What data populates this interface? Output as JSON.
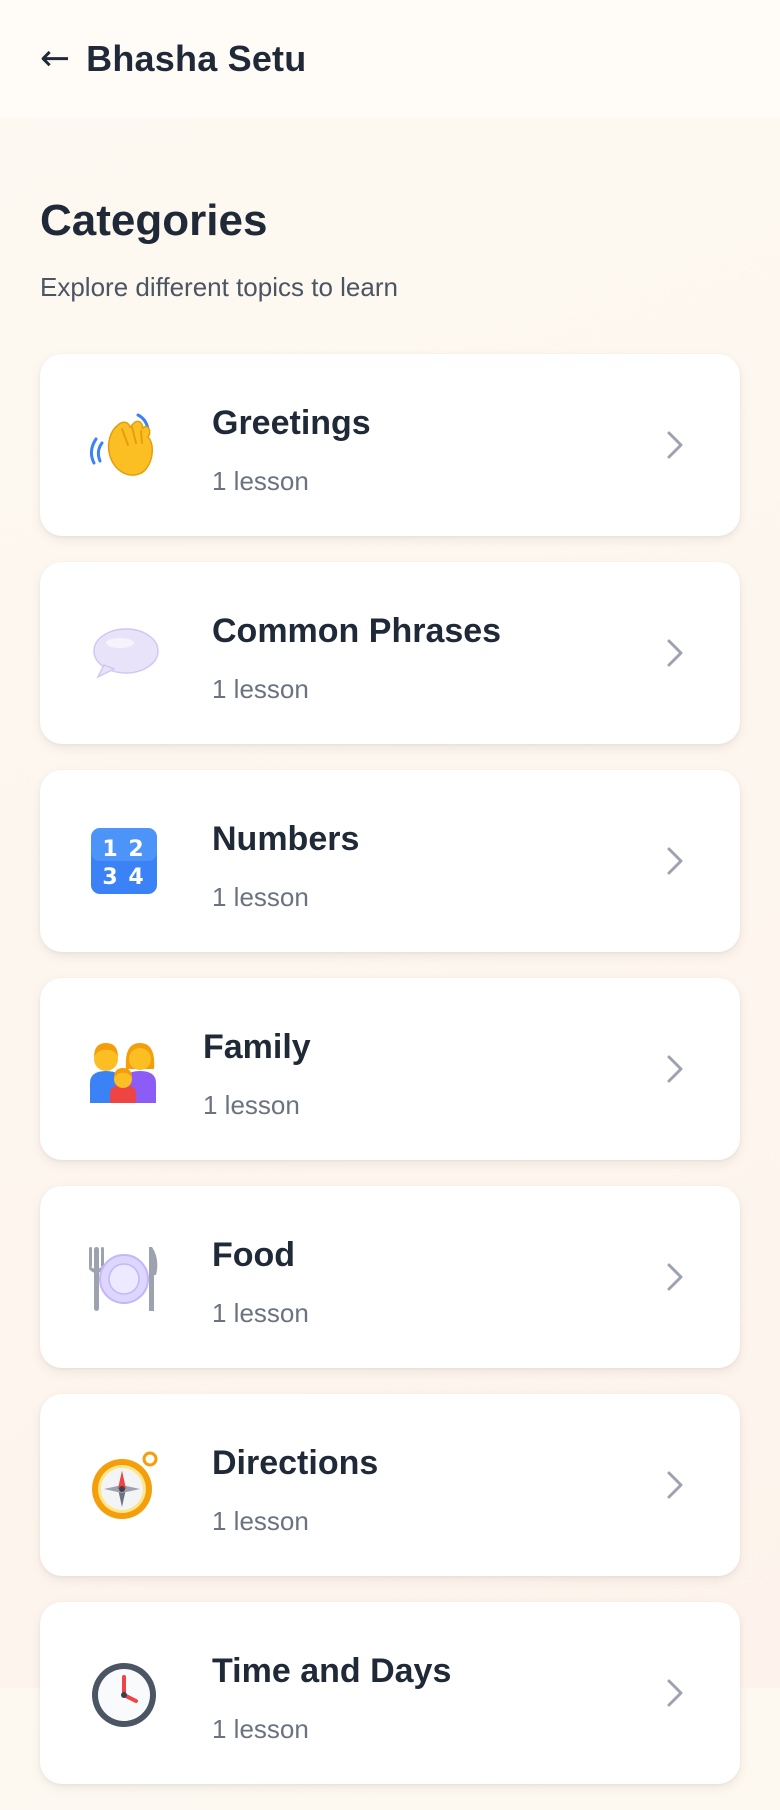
{
  "header": {
    "back_label": "←",
    "title": "Bhasha Setu"
  },
  "page": {
    "heading": "Categories",
    "subheading": "Explore different topics to learn"
  },
  "categories": [
    {
      "title": "Greetings",
      "lessons": "1 lesson",
      "icon": "waving-hand-icon"
    },
    {
      "title": "Common Phrases",
      "lessons": "1 lesson",
      "icon": "speech-bubble-icon"
    },
    {
      "title": "Numbers",
      "lessons": "1 lesson",
      "icon": "numbers-keycap-icon"
    },
    {
      "title": "Family",
      "lessons": "1 lesson",
      "icon": "family-icon"
    },
    {
      "title": "Food",
      "lessons": "1 lesson",
      "icon": "plate-fork-knife-icon"
    },
    {
      "title": "Directions",
      "lessons": "1 lesson",
      "icon": "compass-icon"
    },
    {
      "title": "Time and Days",
      "lessons": "1 lesson",
      "icon": "clock-icon"
    }
  ],
  "colors": {
    "text": "#1f2937",
    "muted": "#6b7280",
    "card": "#ffffff",
    "chevron": "#9ca3af"
  }
}
